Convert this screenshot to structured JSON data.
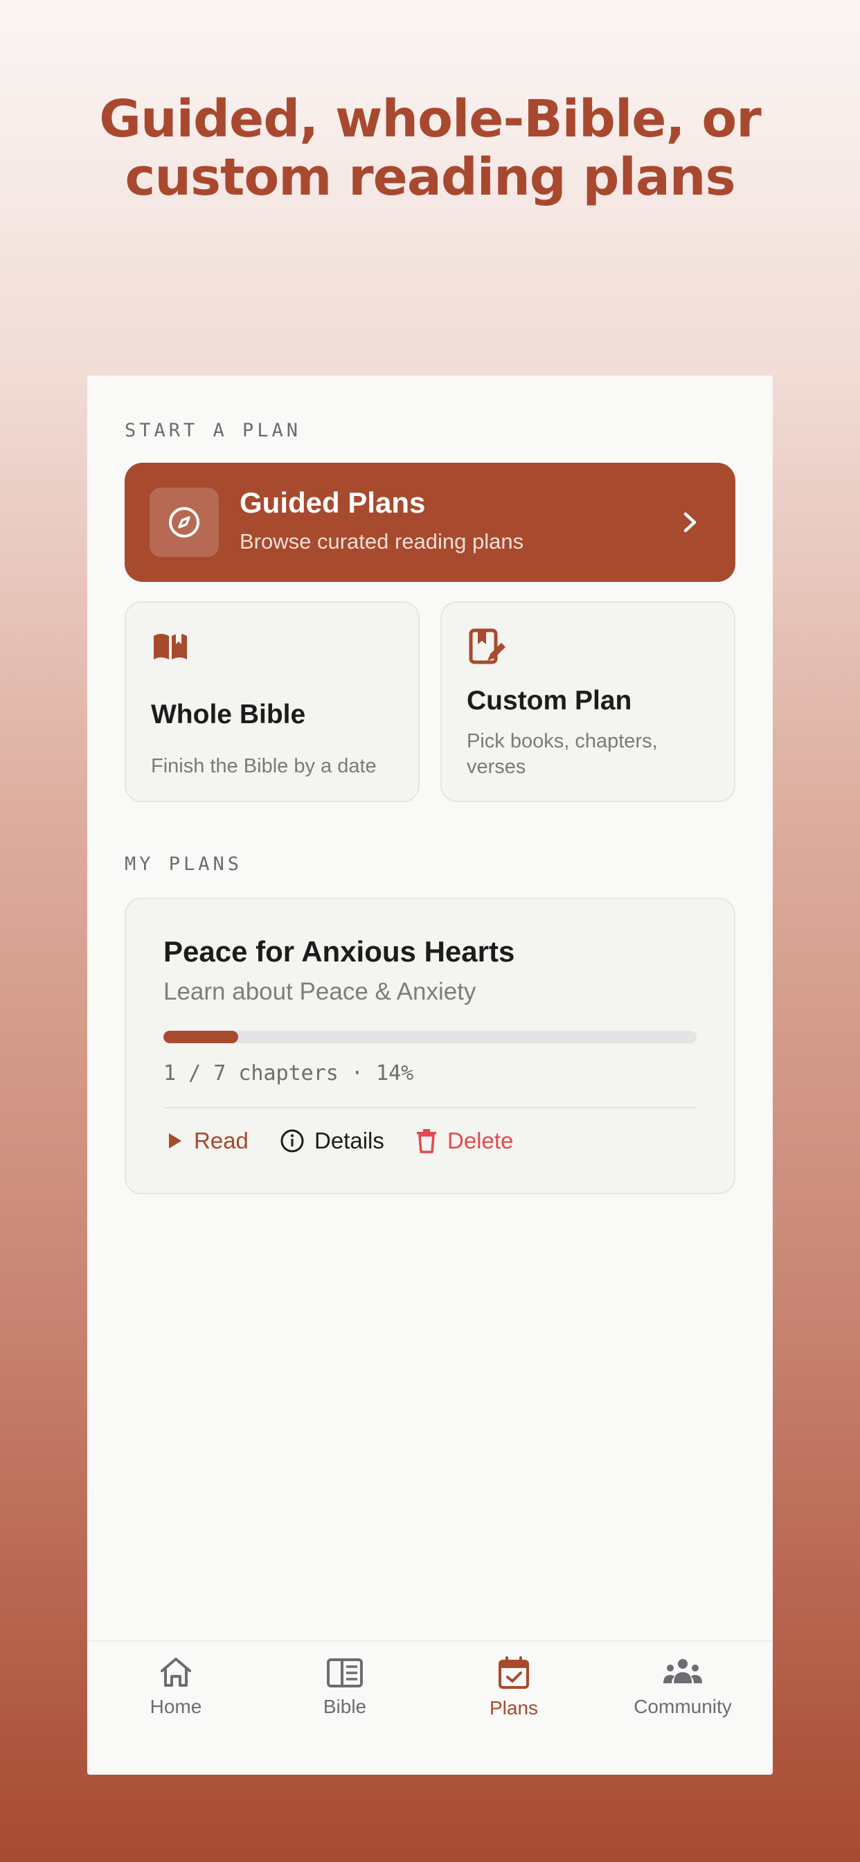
{
  "headline": {
    "line1": "Guided, whole-Bible, or",
    "line2": "custom reading plans"
  },
  "start_section": {
    "label": "START A PLAN"
  },
  "guided_plans": {
    "title": "Guided Plans",
    "subtitle": "Browse curated reading plans",
    "icon": "compass-icon"
  },
  "whole_bible": {
    "title": "Whole Bible",
    "subtitle": "Finish the Bible by a date",
    "icon": "open-book-icon"
  },
  "custom_plan": {
    "title": "Custom Plan",
    "subtitle": "Pick books, chapters, verses",
    "icon": "edit-bookmark-icon"
  },
  "my_plans": {
    "label": "MY PLANS",
    "plans": [
      {
        "title": "Peace for Anxious Hearts",
        "subtitle": "Learn about Peace & Anxiety",
        "progress_percent": 14,
        "meta": "1 / 7 chapters · 14%",
        "actions": {
          "read": "Read",
          "details": "Details",
          "delete": "Delete"
        }
      }
    ]
  },
  "tabs": [
    {
      "label": "Home",
      "icon": "home-icon"
    },
    {
      "label": "Bible",
      "icon": "book-icon"
    },
    {
      "label": "Plans",
      "icon": "calendar-check-icon",
      "active": true
    },
    {
      "label": "Community",
      "icon": "people-icon"
    }
  ],
  "colors": {
    "accent": "#a74a2e",
    "delete": "#e5484d",
    "text": "#1c1c1c",
    "muted": "#7a7a7a"
  }
}
